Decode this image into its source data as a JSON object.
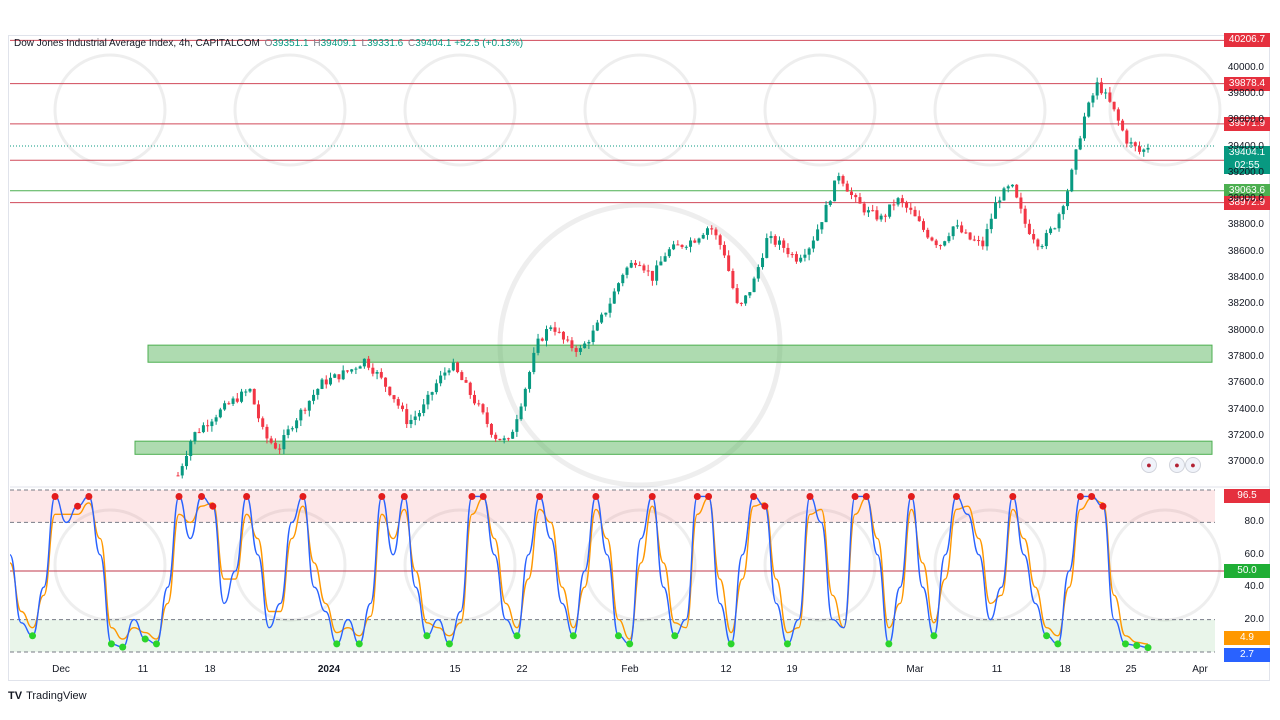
{
  "legend": {
    "symbol": "Dow Jones Industrial Average Index, 4h, CAPITALCOM",
    "open_label": "O",
    "open": "39351.1",
    "high_label": "H",
    "high": "39409.1",
    "low_label": "L",
    "low": "39331.6",
    "close_label": "C",
    "close": "39404.1",
    "change": "+52.5 (+0.13%)"
  },
  "countdown": "02:55",
  "brand": {
    "logo": "TV",
    "name": "TradingView"
  },
  "colors": {
    "up": "#089981",
    "down": "#f23645",
    "zone_green": "#8fd19e",
    "resistance": "#d04a5a",
    "support": "#4caf50",
    "stoch_k": "#2962ff",
    "stoch_d": "#ff9800",
    "dot_red": "#e31c1c",
    "dot_green": "#2bd52b"
  },
  "chart_data": [
    {
      "type": "candlestick",
      "title": "Dow Jones Industrial Average Index, 4h, CAPITALCOM",
      "x_ticks": [
        "Dec",
        "11",
        "18",
        "2024",
        "15",
        "22",
        "Feb",
        "12",
        "19",
        "Mar",
        "11",
        "18",
        "25",
        "Apr"
      ],
      "y_ticks": [
        37000,
        37200,
        37400,
        37600,
        37800,
        38000,
        38200,
        38400,
        38600,
        38800,
        39000,
        39200,
        39400,
        39600,
        39800,
        40000
      ],
      "ylim": [
        36880,
        40240
      ],
      "price_path": [
        [
          0,
          36900
        ],
        [
          2,
          37200
        ],
        [
          5,
          37350
        ],
        [
          8,
          37480
        ],
        [
          10,
          37550
        ],
        [
          12,
          37200
        ],
        [
          14,
          37100
        ],
        [
          16,
          37300
        ],
        [
          20,
          37600
        ],
        [
          24,
          37700
        ],
        [
          26,
          37780
        ],
        [
          28,
          37650
        ],
        [
          30,
          37500
        ],
        [
          32,
          37300
        ],
        [
          34,
          37400
        ],
        [
          36,
          37600
        ],
        [
          38,
          37750
        ],
        [
          40,
          37580
        ],
        [
          42,
          37400
        ],
        [
          44,
          37200
        ],
        [
          46,
          37150
        ],
        [
          48,
          37500
        ],
        [
          50,
          37900
        ],
        [
          52,
          38050
        ],
        [
          54,
          37900
        ],
        [
          56,
          37850
        ],
        [
          58,
          38000
        ],
        [
          60,
          38200
        ],
        [
          62,
          38450
        ],
        [
          64,
          38550
        ],
        [
          66,
          38400
        ],
        [
          68,
          38600
        ],
        [
          70,
          38650
        ],
        [
          72,
          38700
        ],
        [
          74,
          38800
        ],
        [
          76,
          38600
        ],
        [
          78,
          38150
        ],
        [
          80,
          38350
        ],
        [
          82,
          38700
        ],
        [
          84,
          38650
        ],
        [
          86,
          38550
        ],
        [
          88,
          38650
        ],
        [
          90,
          38900
        ],
        [
          92,
          39200
        ],
        [
          94,
          39000
        ],
        [
          96,
          38900
        ],
        [
          98,
          38850
        ],
        [
          100,
          39000
        ],
        [
          102,
          38900
        ],
        [
          104,
          38750
        ],
        [
          106,
          38650
        ],
        [
          108,
          38800
        ],
        [
          110,
          38700
        ],
        [
          112,
          38650
        ],
        [
          114,
          39000
        ],
        [
          116,
          39100
        ],
        [
          118,
          38800
        ],
        [
          120,
          38650
        ],
        [
          122,
          38800
        ],
        [
          124,
          39100
        ],
        [
          126,
          39600
        ],
        [
          128,
          39880
        ],
        [
          130,
          39700
        ],
        [
          132,
          39450
        ],
        [
          134,
          39350
        ],
        [
          135,
          39404
        ]
      ],
      "levels": [
        {
          "value": 40206.7,
          "label": "40206.7",
          "kind": "resistance"
        },
        {
          "value": 39878.4,
          "label": "39878.4",
          "kind": "resistance"
        },
        {
          "value": 39571.9,
          "label": "39571.9",
          "kind": "resistance"
        },
        {
          "value": 39295.8,
          "label": "39295.8",
          "kind": "resistance"
        },
        {
          "value": 39063.6,
          "label": "39063.6",
          "kind": "support"
        },
        {
          "value": 38972.9,
          "label": "38972.9",
          "kind": "resistance"
        }
      ],
      "last_price": {
        "value": 39404.1,
        "label": "39404.1"
      },
      "zones": [
        {
          "from": 37760,
          "to": 37890
        },
        {
          "from": 37060,
          "to": 37160
        }
      ]
    },
    {
      "type": "line",
      "title": "Stochastic",
      "y_ticks": [
        20.0,
        40.0,
        60.0,
        80.0
      ],
      "ylim": [
        0,
        100
      ],
      "bands": {
        "overbought": 80,
        "oversold": 20,
        "mid": 50
      },
      "k_path": [
        [
          0,
          60
        ],
        [
          1,
          18
        ],
        [
          2,
          10
        ],
        [
          3,
          40
        ],
        [
          4,
          96
        ],
        [
          5,
          80
        ],
        [
          6,
          90
        ],
        [
          7,
          96
        ],
        [
          8,
          60
        ],
        [
          9,
          5
        ],
        [
          10,
          3
        ],
        [
          11,
          20
        ],
        [
          12,
          8
        ],
        [
          13,
          5
        ],
        [
          14,
          40
        ],
        [
          15,
          96
        ],
        [
          16,
          70
        ],
        [
          17,
          96
        ],
        [
          18,
          90
        ],
        [
          19,
          30
        ],
        [
          20,
          50
        ],
        [
          21,
          96
        ],
        [
          22,
          60
        ],
        [
          23,
          15
        ],
        [
          24,
          30
        ],
        [
          25,
          80
        ],
        [
          26,
          96
        ],
        [
          27,
          40
        ],
        [
          28,
          25
        ],
        [
          29,
          5
        ],
        [
          30,
          20
        ],
        [
          31,
          5
        ],
        [
          32,
          30
        ],
        [
          33,
          96
        ],
        [
          34,
          60
        ],
        [
          35,
          96
        ],
        [
          36,
          40
        ],
        [
          37,
          10
        ],
        [
          38,
          20
        ],
        [
          39,
          5
        ],
        [
          40,
          25
        ],
        [
          41,
          96
        ],
        [
          42,
          96
        ],
        [
          43,
          60
        ],
        [
          44,
          20
        ],
        [
          45,
          10
        ],
        [
          46,
          60
        ],
        [
          47,
          96
        ],
        [
          48,
          70
        ],
        [
          49,
          30
        ],
        [
          50,
          10
        ],
        [
          51,
          50
        ],
        [
          52,
          96
        ],
        [
          53,
          60
        ],
        [
          54,
          10
        ],
        [
          55,
          5
        ],
        [
          56,
          70
        ],
        [
          57,
          96
        ],
        [
          58,
          40
        ],
        [
          59,
          10
        ],
        [
          60,
          20
        ],
        [
          61,
          96
        ],
        [
          62,
          96
        ],
        [
          63,
          30
        ],
        [
          64,
          5
        ],
        [
          65,
          60
        ],
        [
          66,
          96
        ],
        [
          67,
          90
        ],
        [
          68,
          30
        ],
        [
          69,
          5
        ],
        [
          70,
          20
        ],
        [
          71,
          96
        ],
        [
          72,
          80
        ],
        [
          73,
          20
        ],
        [
          74,
          15
        ],
        [
          75,
          96
        ],
        [
          76,
          96
        ],
        [
          77,
          60
        ],
        [
          78,
          5
        ],
        [
          79,
          40
        ],
        [
          80,
          96
        ],
        [
          81,
          40
        ],
        [
          82,
          10
        ],
        [
          83,
          60
        ],
        [
          84,
          96
        ],
        [
          85,
          85
        ],
        [
          86,
          60
        ],
        [
          87,
          20
        ],
        [
          88,
          40
        ],
        [
          89,
          96
        ],
        [
          90,
          60
        ],
        [
          91,
          30
        ],
        [
          92,
          10
        ],
        [
          93,
          5
        ],
        [
          94,
          50
        ],
        [
          95,
          96
        ],
        [
          96,
          96
        ],
        [
          97,
          90
        ],
        [
          98,
          20
        ],
        [
          99,
          5
        ],
        [
          100,
          4
        ],
        [
          101,
          2.7
        ]
      ],
      "d_path": [
        [
          0,
          55
        ],
        [
          1,
          25
        ],
        [
          2,
          15
        ],
        [
          3,
          35
        ],
        [
          4,
          85
        ],
        [
          5,
          85
        ],
        [
          6,
          85
        ],
        [
          7,
          92
        ],
        [
          8,
          70
        ],
        [
          9,
          15
        ],
        [
          10,
          8
        ],
        [
          11,
          15
        ],
        [
          12,
          12
        ],
        [
          13,
          8
        ],
        [
          14,
          30
        ],
        [
          15,
          85
        ],
        [
          16,
          80
        ],
        [
          17,
          90
        ],
        [
          18,
          92
        ],
        [
          19,
          45
        ],
        [
          20,
          45
        ],
        [
          21,
          85
        ],
        [
          22,
          70
        ],
        [
          23,
          25
        ],
        [
          24,
          25
        ],
        [
          25,
          70
        ],
        [
          26,
          90
        ],
        [
          27,
          55
        ],
        [
          28,
          30
        ],
        [
          29,
          12
        ],
        [
          30,
          15
        ],
        [
          31,
          10
        ],
        [
          32,
          22
        ],
        [
          33,
          85
        ],
        [
          34,
          70
        ],
        [
          35,
          88
        ],
        [
          36,
          50
        ],
        [
          37,
          18
        ],
        [
          38,
          15
        ],
        [
          39,
          10
        ],
        [
          40,
          18
        ],
        [
          41,
          85
        ],
        [
          42,
          95
        ],
        [
          43,
          70
        ],
        [
          44,
          30
        ],
        [
          45,
          15
        ],
        [
          46,
          45
        ],
        [
          47,
          88
        ],
        [
          48,
          80
        ],
        [
          49,
          40
        ],
        [
          50,
          15
        ],
        [
          51,
          40
        ],
        [
          52,
          88
        ],
        [
          53,
          70
        ],
        [
          54,
          20
        ],
        [
          55,
          8
        ],
        [
          56,
          55
        ],
        [
          57,
          90
        ],
        [
          58,
          55
        ],
        [
          59,
          18
        ],
        [
          60,
          15
        ],
        [
          61,
          85
        ],
        [
          62,
          95
        ],
        [
          63,
          45
        ],
        [
          64,
          12
        ],
        [
          65,
          45
        ],
        [
          66,
          90
        ],
        [
          67,
          92
        ],
        [
          68,
          45
        ],
        [
          69,
          12
        ],
        [
          70,
          15
        ],
        [
          71,
          85
        ],
        [
          72,
          88
        ],
        [
          73,
          35
        ],
        [
          74,
          15
        ],
        [
          75,
          85
        ],
        [
          76,
          95
        ],
        [
          77,
          70
        ],
        [
          78,
          15
        ],
        [
          79,
          30
        ],
        [
          80,
          88
        ],
        [
          81,
          55
        ],
        [
          82,
          18
        ],
        [
          83,
          45
        ],
        [
          84,
          88
        ],
        [
          85,
          90
        ],
        [
          86,
          70
        ],
        [
          87,
          30
        ],
        [
          88,
          35
        ],
        [
          89,
          88
        ],
        [
          90,
          70
        ],
        [
          91,
          40
        ],
        [
          92,
          15
        ],
        [
          93,
          10
        ],
        [
          94,
          40
        ],
        [
          95,
          88
        ],
        [
          96,
          95
        ],
        [
          97,
          92
        ],
        [
          98,
          35
        ],
        [
          99,
          10
        ],
        [
          100,
          6
        ],
        [
          101,
          4.9
        ]
      ],
      "values": {
        "k": {
          "value": 2.7,
          "label": "2.7"
        },
        "d": {
          "value": 4.9,
          "label": "4.9"
        },
        "upper": {
          "value": 96.5,
          "label": "96.5"
        },
        "mid": {
          "value": 50.0,
          "label": "50.0"
        }
      }
    }
  ]
}
